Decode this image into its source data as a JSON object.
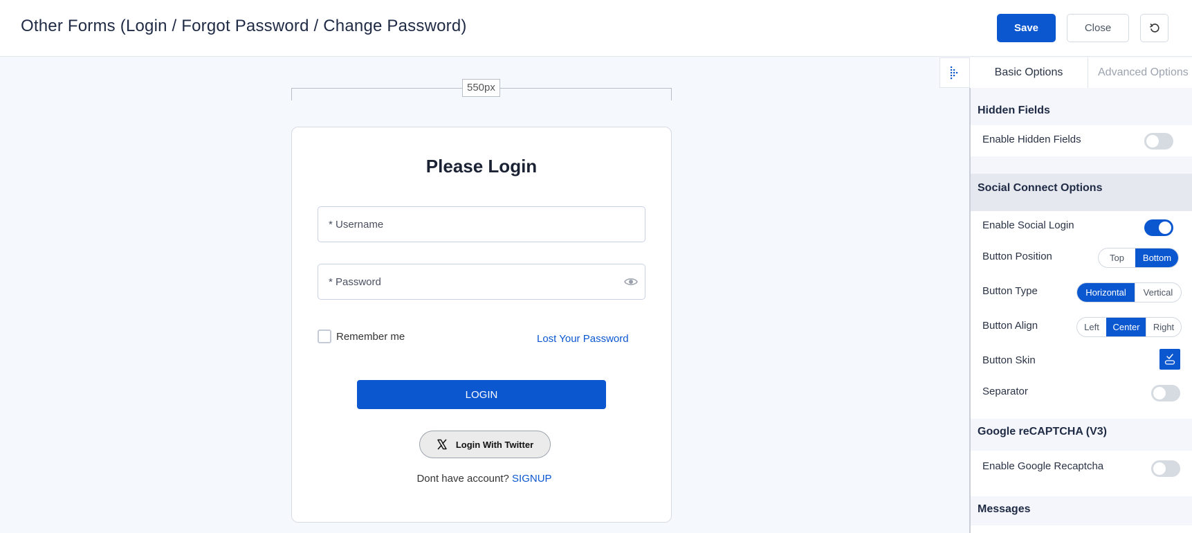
{
  "header": {
    "title": "Other Forms (Login / Forgot Password / Change Password)",
    "save_label": "Save",
    "close_label": "Close"
  },
  "canvas": {
    "width_label": "550px"
  },
  "login_form": {
    "title": "Please Login",
    "username_placeholder": "* Username",
    "password_placeholder": "* Password",
    "remember_label": "Remember me",
    "lost_password_label": "Lost Your Password",
    "login_button": "LOGIN",
    "twitter_button": "Login With Twitter",
    "signup_prompt": "Dont have account?",
    "signup_link": "SIGNUP"
  },
  "panel": {
    "tabs": [
      {
        "label": "Basic Options",
        "active": true
      },
      {
        "label": "Advanced Options",
        "active": false
      }
    ],
    "hidden_fields": {
      "title": "Hidden Fields",
      "enable_label": "Enable Hidden Fields",
      "enabled": false
    },
    "social": {
      "title": "Social Connect Options",
      "enable_label": "Enable Social Login",
      "enabled": true,
      "position_label": "Button Position",
      "position_options": [
        "Top",
        "Bottom"
      ],
      "position_selected": "Bottom",
      "type_label": "Button Type",
      "type_options": [
        "Horizontal",
        "Vertical"
      ],
      "type_selected": "Horizontal",
      "align_label": "Button Align",
      "align_options": [
        "Left",
        "Center",
        "Right"
      ],
      "align_selected": "Center",
      "skin_label": "Button Skin",
      "separator_label": "Separator",
      "separator_enabled": false
    },
    "recaptcha": {
      "title": "Google reCAPTCHA (V3)",
      "enable_label": "Enable Google Recaptcha",
      "enabled": false
    },
    "messages": {
      "title": "Messages"
    }
  },
  "colors": {
    "accent": "#0b57d0",
    "link": "#0b57d0"
  },
  "icons": {
    "reset": "undo-icon",
    "eye": "eye-icon",
    "twitter": "x-logo-icon",
    "panel": "dots-grid-icon",
    "skin": "skin-check-icon"
  }
}
